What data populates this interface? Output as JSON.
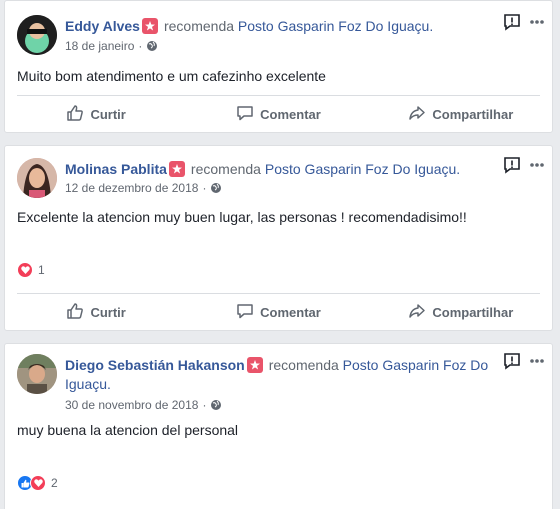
{
  "posts": [
    {
      "author": "Eddy Alves",
      "action": "recomenda",
      "page": "Posto Gasparin Foz Do Iguaçu.",
      "date": "18 de janeiro",
      "text": "Muito bom atendimento e um cafezinho excelente",
      "reaction_count": "",
      "avatar_color": "#2b2b2b"
    },
    {
      "author": "Molinas Pablita",
      "action": "recomenda",
      "page": "Posto Gasparin Foz Do Iguaçu.",
      "date": "12 de dezembro de 2018",
      "text": "Excelente la atencion muy buen lugar, las personas ! recomendadisimo!!",
      "reaction_count": "1",
      "avatar_color": "#c98a86"
    },
    {
      "author": "Diego Sebastián Hakanson",
      "action": "recomenda",
      "page_part1": "Posto Gasparin Foz Do",
      "page_part2": "Iguaçu.",
      "date": "30 de novembro de 2018",
      "text": "muy buena la atencion del personal",
      "reaction_count": "2",
      "avatar_color": "#8b7d6b"
    }
  ],
  "actions": {
    "like": "Curtir",
    "comment": "Comentar",
    "share": "Compartilhar"
  },
  "separator": "·",
  "icons": {
    "badge": "recommend-star-icon",
    "globe": "globe-icon",
    "report": "report-icon",
    "more": "more-icon"
  },
  "colors": {
    "link": "#365899",
    "badge": "#e9546a",
    "love": "#f33e58",
    "like": "#1877f2"
  }
}
